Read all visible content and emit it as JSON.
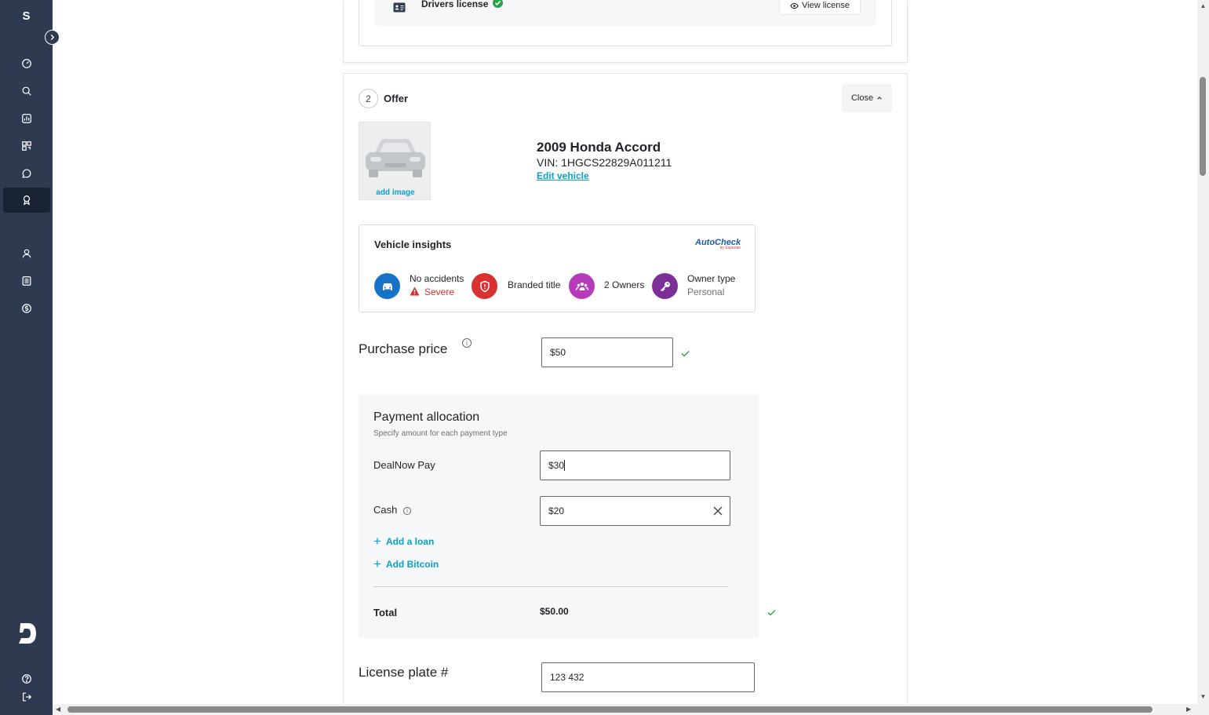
{
  "sidebar": {
    "brand": "S",
    "nav": [
      {
        "name": "dashboard-icon",
        "active": false
      },
      {
        "name": "search-icon",
        "active": false
      },
      {
        "name": "reports-icon",
        "active": false
      },
      {
        "name": "qr-code-icon",
        "active": false
      },
      {
        "name": "chat-icon",
        "active": false
      },
      {
        "name": "award-icon",
        "active": true
      },
      {
        "name": "user-icon",
        "active": false
      },
      {
        "name": "list-icon",
        "active": false
      },
      {
        "name": "dollar-icon",
        "active": false
      }
    ],
    "bottom": [
      {
        "name": "help-icon"
      },
      {
        "name": "logout-icon"
      }
    ]
  },
  "license": {
    "label": "Drivers license",
    "view_label": "View license"
  },
  "offer": {
    "step_number": "2",
    "title": "Offer",
    "close_label": "Close"
  },
  "vehicle": {
    "add_image_label": "add image",
    "title": "2009 Honda Accord",
    "vin": "VIN: 1HGCS22829A011211",
    "edit_label": "Edit vehicle"
  },
  "insights": {
    "title": "Vehicle insights",
    "provider": "AutoCheck",
    "provider_sub": "by Experian",
    "items": [
      {
        "label": "No accidents",
        "sub": "Severe",
        "color": "#1673c9"
      },
      {
        "label": "Branded title",
        "sub": "",
        "color": "#d8312f"
      },
      {
        "label": "2 Owners",
        "sub": "",
        "color": "#b63bb9"
      },
      {
        "label": "Owner type",
        "sub": "Personal",
        "color": "#7b2f97"
      }
    ]
  },
  "purchase": {
    "label": "Purchase price",
    "value": "$50"
  },
  "allocation": {
    "title": "Payment allocation",
    "subtitle": "Specify amount for each payment type",
    "dealnow_label": "DealNow Pay",
    "dealnow_value": "$30",
    "cash_label": "Cash",
    "cash_value": "$20",
    "add_loan": "Add a loan",
    "add_bitcoin": "Add Bitcoin",
    "total_label": "Total",
    "total_value": "$50.00"
  },
  "plate": {
    "label": "License plate #",
    "value": "123 432"
  },
  "colors": {
    "sidebar": "#2d3a4f",
    "accent": "#0c9fc7",
    "success": "#27a24a",
    "danger": "#d8312f"
  }
}
